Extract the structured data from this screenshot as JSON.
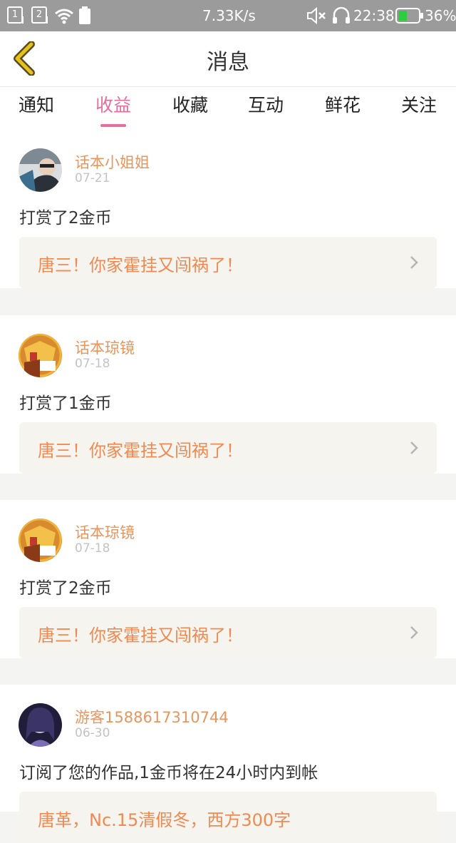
{
  "status_bar": {
    "sim1": "1",
    "sim2": "2",
    "speed": "7.33K/s",
    "time": "22:38",
    "battery": "36%",
    "icons": [
      "sim1-icon",
      "sim2-icon",
      "wifi-icon",
      "battery-small-icon",
      "mute-icon",
      "headset-icon",
      "battery-icon"
    ],
    "battery_color": "#2ecc40"
  },
  "header": {
    "title": "消息",
    "back_icon": "back-chevron-icon",
    "back_color": "#e6c21f"
  },
  "tabs": [
    {
      "label": "通知"
    },
    {
      "label": "收益",
      "active": true
    },
    {
      "label": "收藏"
    },
    {
      "label": "互动"
    },
    {
      "label": "鲜花"
    },
    {
      "label": "关注"
    }
  ],
  "accent_color": "#e46f9f",
  "messages": [
    {
      "user": "话本小姐姐",
      "date": "07-21",
      "action": "打赏了2金币",
      "ref": "唐三！你家霍挂又闯祸了！"
    },
    {
      "user": "话本琼镜",
      "date": "07-18",
      "action": "打赏了1金币",
      "ref": "唐三！你家霍挂又闯祸了！"
    },
    {
      "user": "话本琼镜",
      "date": "07-18",
      "action": "打赏了2金币",
      "ref": "唐三！你家霍挂又闯祸了！"
    },
    {
      "user": "游客1588617310744",
      "date": "06-30",
      "action": "订阅了您的作品,1金币将在24小时内到帐",
      "ref": "唐革，Nc.15清假冬，西方300字"
    }
  ]
}
